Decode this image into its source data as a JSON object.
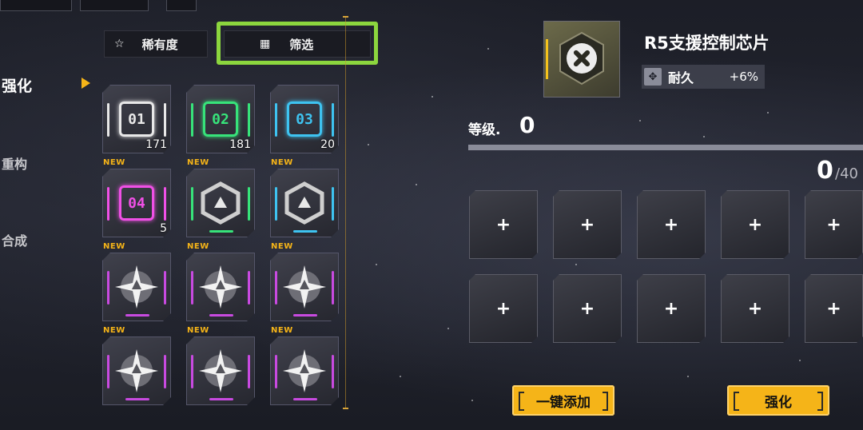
{
  "nav": {
    "items": [
      {
        "label": "强化",
        "active": true
      },
      {
        "label": "重构",
        "active": false
      },
      {
        "label": "合成",
        "active": false
      }
    ]
  },
  "filters": {
    "rarity_label": "稀有度",
    "filter_label": "筛选"
  },
  "inventory": [
    {
      "type": "chip",
      "code": "01",
      "color": "#e8e8e8",
      "count": "171",
      "new": false
    },
    {
      "type": "chip",
      "code": "02",
      "color": "#37e37a",
      "count": "181",
      "new": false
    },
    {
      "type": "chip",
      "code": "03",
      "color": "#3ec3f0",
      "count": "20",
      "new": false
    },
    {
      "type": "chip",
      "code": "04",
      "color": "#f050e6",
      "count": "5",
      "new": true
    },
    {
      "type": "hex",
      "color": "#37e37a",
      "count": "",
      "new": true
    },
    {
      "type": "hex",
      "color": "#3ec3f0",
      "count": "",
      "new": true
    },
    {
      "type": "star",
      "color": "#c84ae0",
      "count": "",
      "new": true
    },
    {
      "type": "star",
      "color": "#c84ae0",
      "count": "",
      "new": true
    },
    {
      "type": "star",
      "color": "#c84ae0",
      "count": "",
      "new": true
    },
    {
      "type": "star",
      "color": "#c84ae0",
      "count": "",
      "new": true
    },
    {
      "type": "star",
      "color": "#c84ae0",
      "count": "",
      "new": true
    },
    {
      "type": "star",
      "color": "#c84ae0",
      "count": "",
      "new": true
    }
  ],
  "new_tag": "NEW",
  "selected": {
    "name": "R5支援控制芯片",
    "stat_name": "耐久",
    "stat_value": "+6%",
    "level_label": "等级.",
    "level_value": "0",
    "exp_current": "0",
    "exp_max": "/40"
  },
  "slot_plus": "+",
  "buttons": {
    "auto_add": "一键添加",
    "enhance": "强化"
  },
  "colors": {
    "accent": "#f5b418",
    "highlight_outline": "#8cd63e"
  }
}
